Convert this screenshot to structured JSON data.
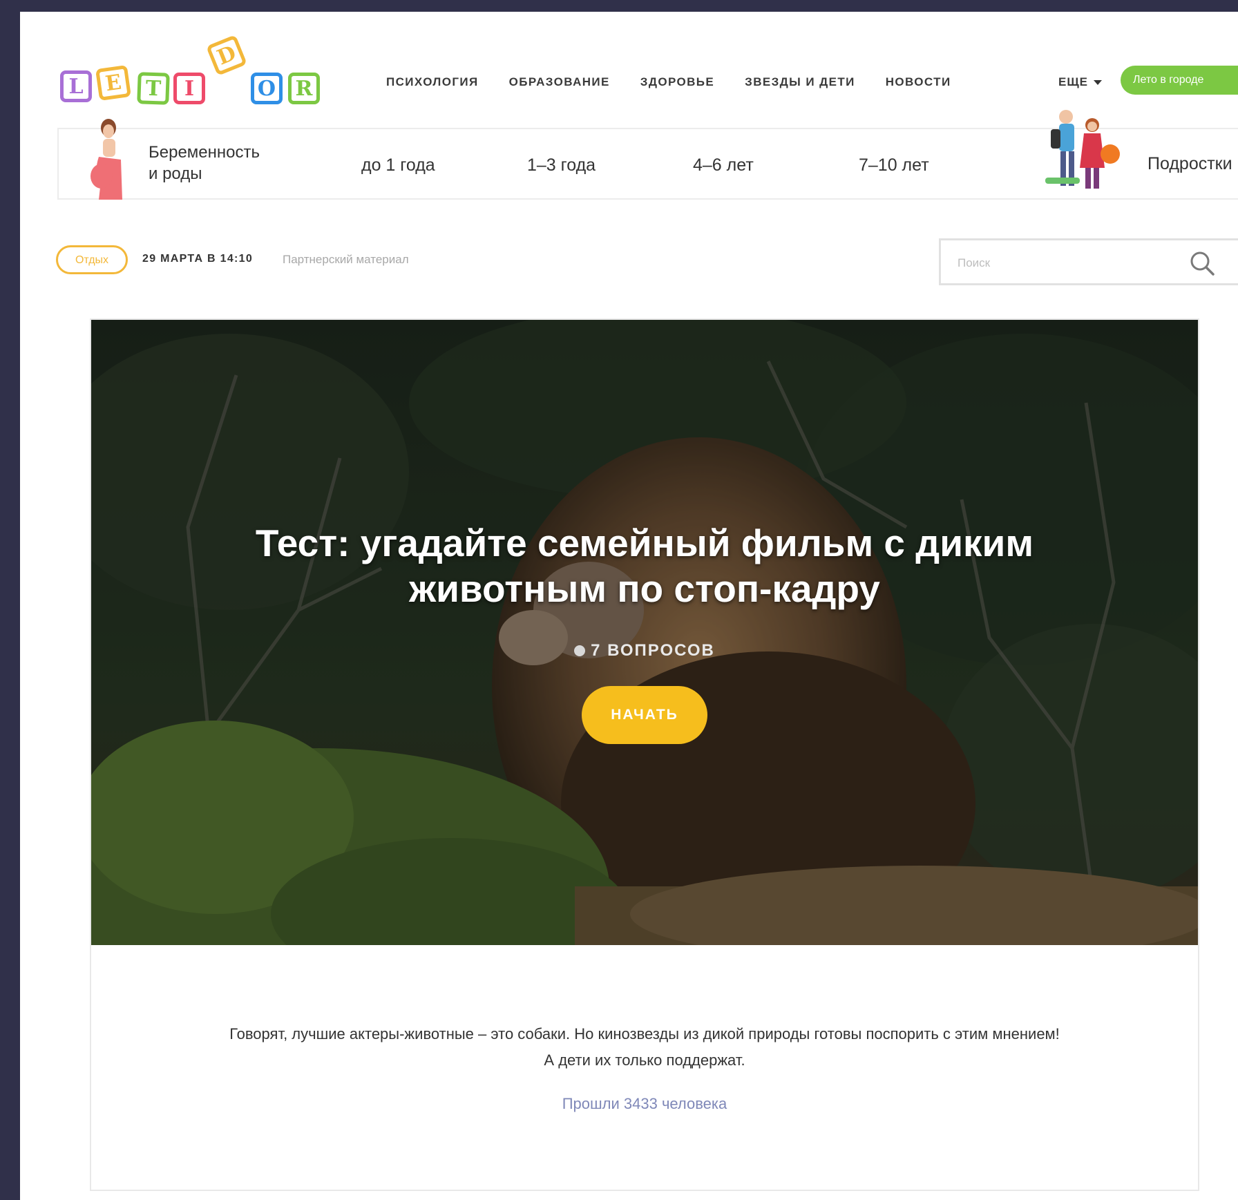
{
  "logo": {
    "letters": [
      "L",
      "E",
      "T",
      "I",
      "D",
      "O",
      "R"
    ],
    "colors": [
      "#a86fd6",
      "#f3b83a",
      "#7cc843",
      "#ee4b6a",
      "#f3b83a",
      "#2f8fe6",
      "#7cc843"
    ]
  },
  "nav": [
    "психология",
    "образование",
    "здоровье",
    "звезды и дети",
    "новости"
  ],
  "more_label": "ЕЩЕ",
  "summer_button": "Лето в городе",
  "age_bar": {
    "pregnancy": "Беременность\nи роды",
    "items": [
      "до 1 года",
      "1–3 года",
      "4–6 лет",
      "7–10 лет"
    ],
    "teens": "Подростки"
  },
  "meta": {
    "tag": "Отдых",
    "date": "29 МАРТА В 14:10",
    "partner": "Партнерский материал"
  },
  "search": {
    "placeholder": "Поиск"
  },
  "quiz": {
    "title": "Тест: угадайте семейный фильм с диким животным по стоп-кадру",
    "questions": "7 ВОПРОСОВ",
    "start_label": "НАЧАТЬ",
    "description_line1": "Говорят, лучшие актеры-животные – это собаки. Но кинозвезды из дикой природы готовы поспорить с этим мнением!",
    "description_line2": "А дети их только поддержат.",
    "passed": "Прошли 3433 человека"
  }
}
